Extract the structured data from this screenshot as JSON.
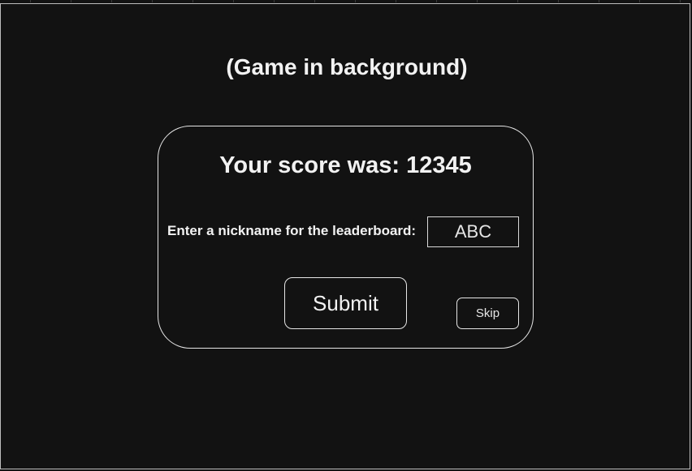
{
  "background": {
    "label": "(Game in background)"
  },
  "dialog": {
    "score_prefix": "Your score was: ",
    "score_value": "12345",
    "nickname_label": "Enter a nickname for the leaderboard:",
    "nickname_value": "ABC",
    "submit_label": "Submit",
    "skip_label": "Skip"
  },
  "colors": {
    "background": "#121212",
    "foreground": "#f2f2f2",
    "border": "#e6e6e6"
  }
}
